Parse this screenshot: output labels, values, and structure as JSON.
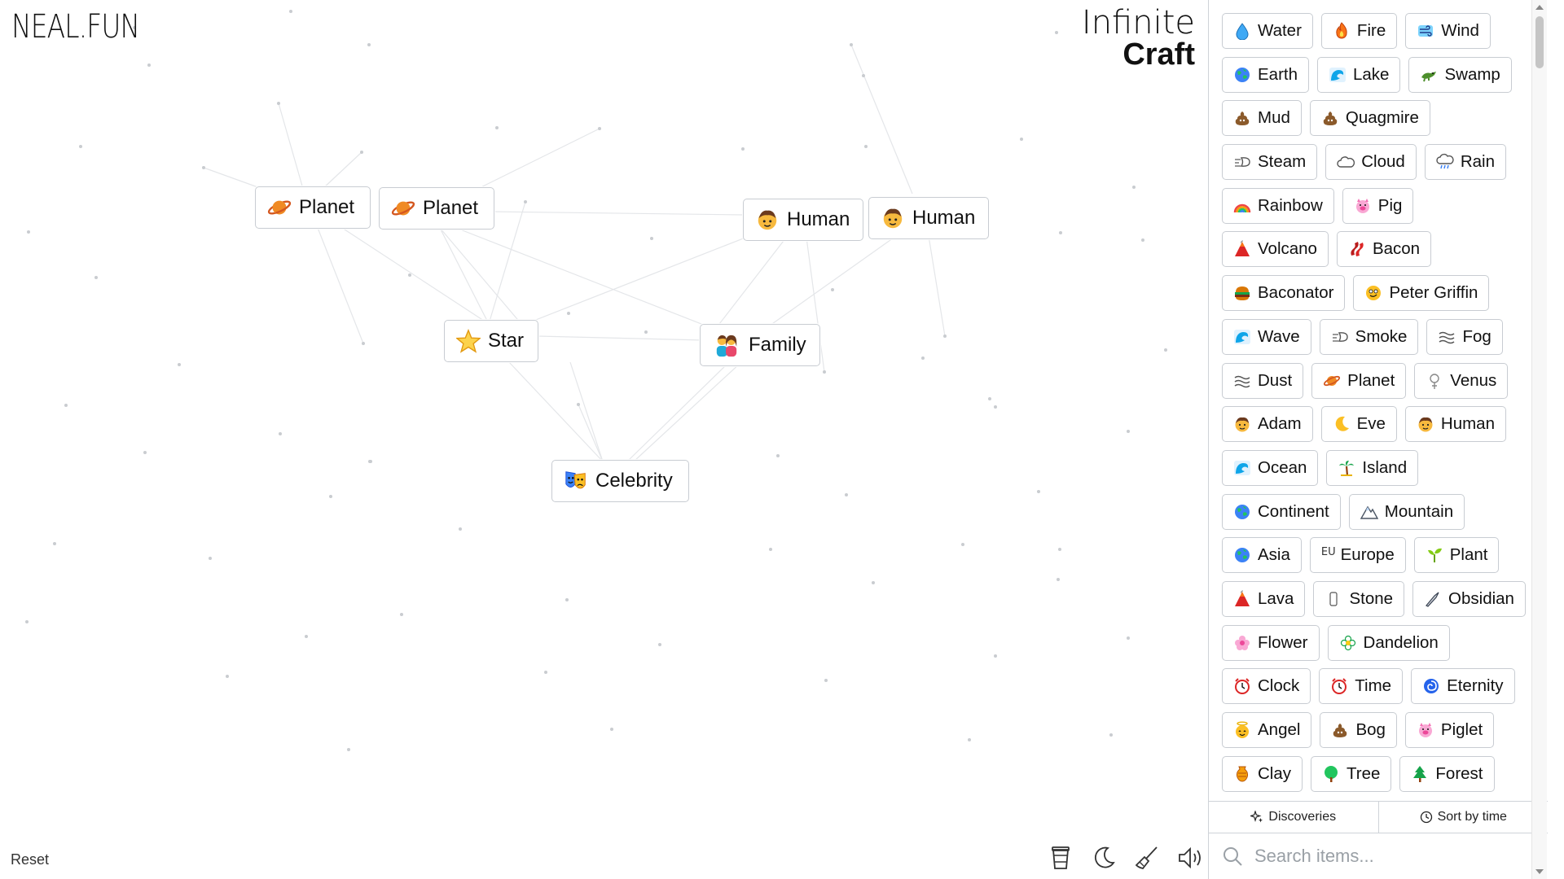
{
  "logo": {
    "left": "NEAL.FUN",
    "right_line1": "Infinite",
    "right_line2": "Craft"
  },
  "canvas": {
    "nodes": [
      {
        "label": "Planet",
        "icon": "planet-icon"
      },
      {
        "label": "Planet",
        "icon": "planet-icon"
      },
      {
        "label": "Human",
        "icon": "human-icon"
      },
      {
        "label": "Human",
        "icon": "human-icon"
      },
      {
        "label": "Star",
        "icon": "star-icon"
      },
      {
        "label": "Family",
        "icon": "family-icon"
      },
      {
        "label": "Celebrity",
        "icon": "celebrity-icon"
      }
    ],
    "reset_label": "Reset",
    "tools": [
      "coffee-cup-icon",
      "moon-icon",
      "broom-icon",
      "speaker-icon"
    ]
  },
  "sidebar": {
    "rows": [
      [
        {
          "label": "Water",
          "icon": "droplet-icon"
        },
        {
          "label": "Fire",
          "icon": "fire-icon"
        },
        {
          "label": "Wind",
          "icon": "wind-icon"
        }
      ],
      [
        {
          "label": "Earth",
          "icon": "globe-icon"
        },
        {
          "label": "Lake",
          "icon": "wave-icon"
        },
        {
          "label": "Swamp",
          "icon": "crocodile-icon"
        }
      ],
      [
        {
          "label": "Mud",
          "icon": "poop-icon"
        },
        {
          "label": "Quagmire",
          "icon": "poop-icon"
        }
      ],
      [
        {
          "label": "Steam",
          "icon": "dash-icon"
        },
        {
          "label": "Cloud",
          "icon": "cloud-icon"
        },
        {
          "label": "Rain",
          "icon": "rain-cloud-icon"
        }
      ],
      [
        {
          "label": "Rainbow",
          "icon": "rainbow-icon"
        },
        {
          "label": "Pig",
          "icon": "pig-icon"
        }
      ],
      [
        {
          "label": "Volcano",
          "icon": "volcano-icon"
        },
        {
          "label": "Bacon",
          "icon": "bacon-icon"
        }
      ],
      [
        {
          "label": "Baconator",
          "icon": "burger-icon"
        },
        {
          "label": "Peter Griffin",
          "icon": "face-icon"
        }
      ],
      [
        {
          "label": "Wave",
          "icon": "wave-icon"
        },
        {
          "label": "Smoke",
          "icon": "dash-icon"
        },
        {
          "label": "Fog",
          "icon": "fog-icon"
        }
      ],
      [
        {
          "label": "Dust",
          "icon": "fog-icon"
        },
        {
          "label": "Planet",
          "icon": "planet-icon"
        },
        {
          "label": "Venus",
          "icon": "venus-icon"
        }
      ],
      [
        {
          "label": "Adam",
          "icon": "human-icon"
        },
        {
          "label": "Eve",
          "icon": "moon-crescent-icon"
        },
        {
          "label": "Human",
          "icon": "human-icon"
        }
      ],
      [
        {
          "label": "Ocean",
          "icon": "wave-icon"
        },
        {
          "label": "Island",
          "icon": "palm-icon"
        }
      ],
      [
        {
          "label": "Continent",
          "icon": "globe-icon"
        },
        {
          "label": "Mountain",
          "icon": "mountain-icon"
        }
      ],
      [
        {
          "label": "Asia",
          "icon": "globe-icon"
        },
        {
          "label": "Europe",
          "icon": "eu-icon",
          "icon_text": "EU"
        },
        {
          "label": "Plant",
          "icon": "seedling-icon"
        }
      ],
      [
        {
          "label": "Lava",
          "icon": "volcano-icon"
        },
        {
          "label": "Stone",
          "icon": "stone-icon"
        },
        {
          "label": "Obsidian",
          "icon": "knife-icon"
        }
      ],
      [
        {
          "label": "Flower",
          "icon": "flower-icon"
        },
        {
          "label": "Dandelion",
          "icon": "blossom-icon"
        }
      ],
      [
        {
          "label": "Clock",
          "icon": "clock-icon"
        },
        {
          "label": "Time",
          "icon": "clock-icon"
        },
        {
          "label": "Eternity",
          "icon": "cyclone-icon"
        }
      ],
      [
        {
          "label": "Angel",
          "icon": "angel-icon"
        },
        {
          "label": "Bog",
          "icon": "poop-icon"
        },
        {
          "label": "Piglet",
          "icon": "pig-icon"
        }
      ],
      [
        {
          "label": "Clay",
          "icon": "vase-icon"
        },
        {
          "label": "Tree",
          "icon": "tree-icon"
        },
        {
          "label": "Forest",
          "icon": "evergreen-icon"
        }
      ]
    ],
    "tabs": {
      "discoveries": "Discoveries",
      "sort": "Sort by time"
    },
    "search_placeholder": "Search items..."
  },
  "colors": {
    "border": "#c8ccd2",
    "line": "#e2e4e7",
    "text": "#111111"
  }
}
